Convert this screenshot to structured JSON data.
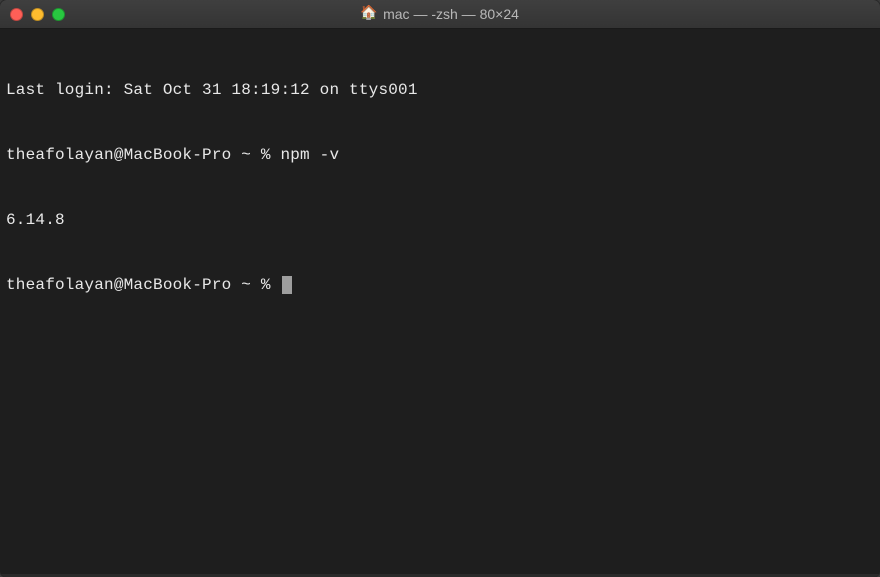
{
  "window": {
    "title": "mac — -zsh — 80×24",
    "icon_name": "home-folder-icon",
    "icon_glyph": "🏠"
  },
  "traffic_lights": {
    "close": "#ff5f57",
    "minimize": "#febc2e",
    "maximize": "#28c840"
  },
  "terminal": {
    "lines": [
      "Last login: Sat Oct 31 18:19:12 on ttys001",
      "theafolayan@MacBook-Pro ~ % npm -v",
      "6.14.8",
      "theafolayan@MacBook-Pro ~ % "
    ],
    "last_login": {
      "day": "Sat",
      "month": "Oct",
      "date": 31,
      "time": "18:19:12",
      "tty": "ttys001"
    },
    "prompt_user": "theafolayan",
    "prompt_host": "MacBook-Pro",
    "prompt_path": "~",
    "prompt_symbol": "%",
    "command": "npm -v",
    "output": "6.14.8"
  },
  "colors": {
    "background": "#1e1e1e",
    "titlebar": "#3a3a3a",
    "text": "#e8e8e8",
    "cursor": "#9e9e9e"
  }
}
